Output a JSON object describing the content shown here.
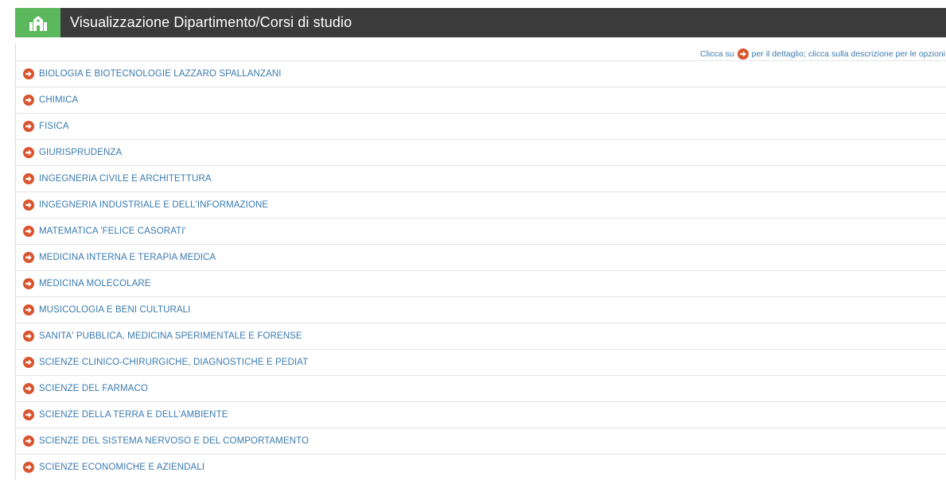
{
  "header": {
    "title": "Visualizzazione Dipartimento/Corsi di studio",
    "icon": "building-icon",
    "accent_color": "#5cb85c",
    "bar_color": "#3b3b3b"
  },
  "hint": {
    "prefix": "Clicca su",
    "suffix": "per il dettaglio; clicca sulla descrizione per le opzioni",
    "icon": "arrow-right-circle-icon"
  },
  "departments": [
    {
      "label": "BIOLOGIA E BIOTECNOLOGIE LAZZARO SPALLANZANI"
    },
    {
      "label": "CHIMICA"
    },
    {
      "label": "FISICA"
    },
    {
      "label": "GIURISPRUDENZA"
    },
    {
      "label": "INGEGNERIA CIVILE E ARCHITETTURA"
    },
    {
      "label": "INGEGNERIA INDUSTRIALE E DELL'INFORMAZIONE"
    },
    {
      "label": "MATEMATICA 'FELICE CASORATI'"
    },
    {
      "label": "MEDICINA INTERNA E TERAPIA MEDICA"
    },
    {
      "label": "MEDICINA MOLECOLARE"
    },
    {
      "label": "MUSICOLOGIA E BENI CULTURALI"
    },
    {
      "label": "SANITA' PUBBLICA, MEDICINA SPERIMENTALE E FORENSE"
    },
    {
      "label": "SCIENZE CLINICO-CHIRURGICHE, DIAGNOSTICHE E PEDIAT"
    },
    {
      "label": "SCIENZE DEL FARMACO"
    },
    {
      "label": "SCIENZE DELLA TERRA E DELL'AMBIENTE"
    },
    {
      "label": "SCIENZE DEL SISTEMA NERVOSO E DEL COMPORTAMENTO"
    },
    {
      "label": "SCIENZE ECONOMICHE E AZIENDALI"
    }
  ],
  "colors": {
    "link": "#3a7ab0",
    "arrow": "#d9532c"
  }
}
